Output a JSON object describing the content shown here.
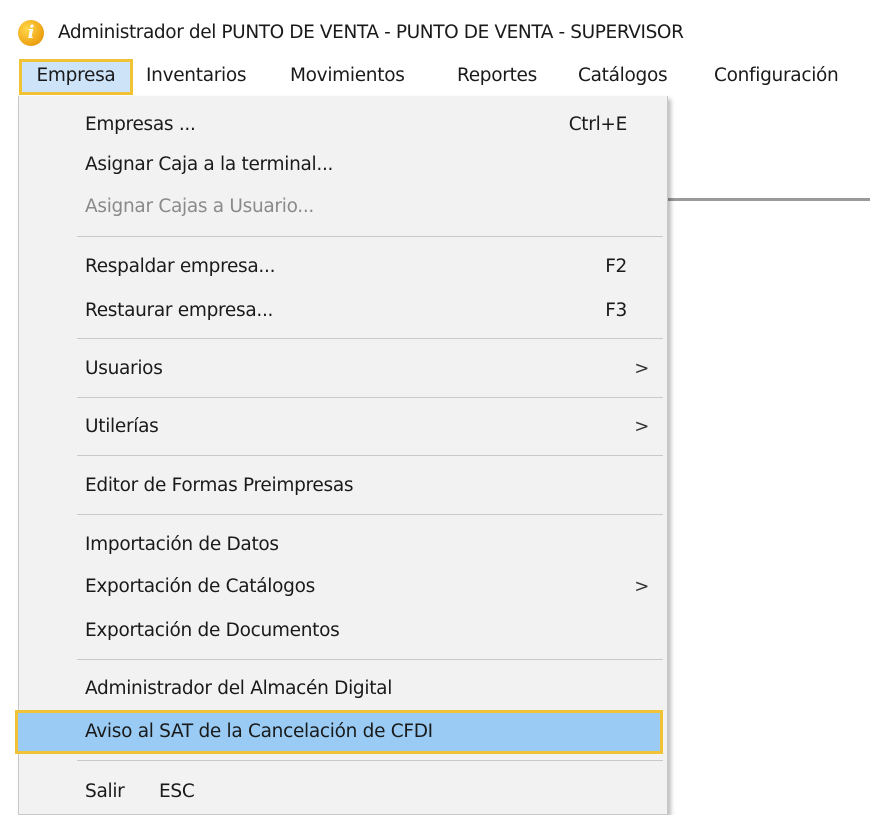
{
  "window": {
    "title": "Administrador del PUNTO DE VENTA - PUNTO DE VENTA - SUPERVISOR",
    "icon": "app-i-icon"
  },
  "menubar": {
    "items": [
      {
        "label": "Empresa"
      },
      {
        "label": "Inventarios"
      },
      {
        "label": "Movimientos"
      },
      {
        "label": "Reportes"
      },
      {
        "label": "Catálogos"
      },
      {
        "label": "Configuración"
      }
    ]
  },
  "empresa_menu": {
    "items": [
      {
        "label": "Empresas ...",
        "shortcut": "Ctrl+E"
      },
      {
        "label": "Asignar Caja a la terminal..."
      },
      {
        "label": "Asignar Cajas a Usuario...",
        "disabled": true
      },
      {
        "label": "Respaldar empresa...",
        "shortcut": "F2"
      },
      {
        "label": "Restaurar empresa...",
        "shortcut": "F3"
      },
      {
        "label": "Usuarios",
        "submenu": true
      },
      {
        "label": "Utilerías",
        "submenu": true
      },
      {
        "label": "Editor de Formas Preimpresas"
      },
      {
        "label": "Importación de Datos"
      },
      {
        "label": "Exportación de Catálogos",
        "submenu": true
      },
      {
        "label": "Exportación de Documentos"
      },
      {
        "label": "Administrador del Almacén Digital"
      },
      {
        "label": "Aviso al SAT de la Cancelación de CFDI",
        "highlighted": true
      },
      {
        "label": "Salir",
        "shortcut": "ESC"
      }
    ],
    "submenu_glyph": ">"
  },
  "colors": {
    "highlight_border": "#f2c236",
    "highlight_fill": "#99cbf4",
    "menu_background": "#f2f2f2"
  }
}
